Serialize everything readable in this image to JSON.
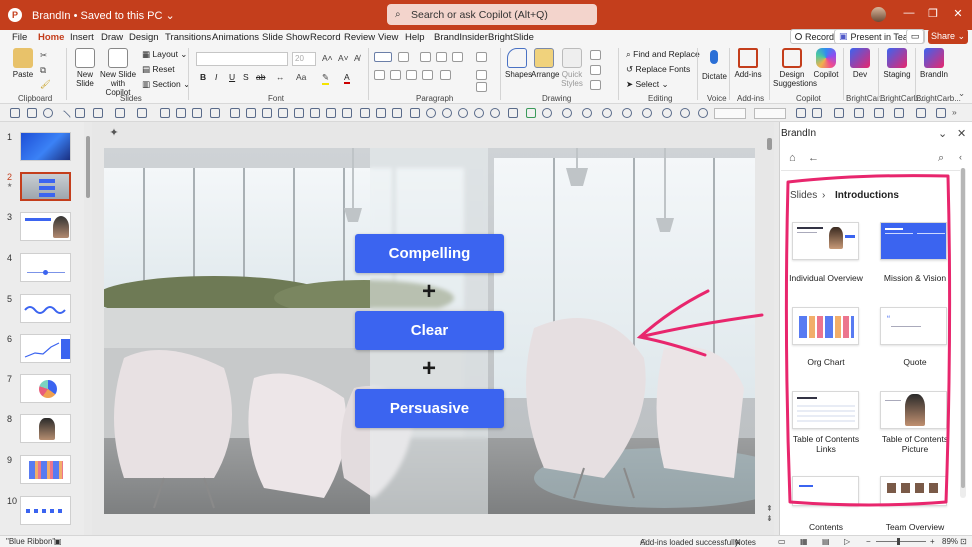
{
  "app": {
    "logo": "P",
    "document_title": "BrandIn • Saved to this PC ⌄",
    "search_placeholder": "Search or ask Copilot (Alt+Q)",
    "brand_color": "#c43e1c"
  },
  "tabs": [
    "File",
    "Home",
    "Insert",
    "Draw",
    "Design",
    "Transitions",
    "Animations",
    "Slide Show",
    "Record",
    "Review",
    "View",
    "Help",
    "BrandInsider",
    "BrightSlide"
  ],
  "active_tab": "Home",
  "actions": {
    "record": "Record",
    "present": "Present in Teams",
    "share": "Share ⌄"
  },
  "ribbon": {
    "groups": [
      "Clipboard",
      "Slides",
      "Font",
      "Paragraph",
      "Drawing",
      "Editing",
      "Voice",
      "Add-ins",
      "Copilot",
      "BrightCar...",
      "BrightCarb...",
      "BrightCarb..."
    ],
    "clipboard": {
      "paste": "Paste"
    },
    "slides": {
      "new_slide": "New Slide",
      "new_slide_copilot": "New Slide with Copilot",
      "layout": "Layout ⌄",
      "reset": "Reset",
      "section": "Section ⌄"
    },
    "font": {
      "size": "20",
      "bold": "B",
      "italic": "I",
      "underline": "U",
      "strike": "S",
      "shadow": "ab"
    },
    "drawing": {
      "shapes": "Shapes",
      "arrange": "Arrange",
      "quick_styles": "Quick Styles"
    },
    "editing": {
      "find_replace": "Find and Replace",
      "replace_fonts": "Replace Fonts",
      "select": "Select ⌄"
    },
    "voice": {
      "dictate": "Dictate"
    },
    "addins": {
      "addins": "Add-ins"
    },
    "copilot": {
      "design_suggestions": "Design Suggestions",
      "copilot": "Copilot"
    },
    "brand": {
      "dev": "Dev",
      "staging": "Staging",
      "brandin": "BrandIn"
    }
  },
  "thumbnails": [
    "1",
    "2",
    "3",
    "4",
    "5",
    "6",
    "7",
    "8",
    "9",
    "10"
  ],
  "selected_slide": "2",
  "slide": {
    "pills": [
      "Compelling",
      "Clear",
      "Persuasive"
    ],
    "plus": "+"
  },
  "pane": {
    "title": "BrandIn",
    "breadcrumb_root": "Slides",
    "breadcrumb_sep": "›",
    "breadcrumb_current": "Introductions",
    "cards": [
      {
        "label": "Individual Overview"
      },
      {
        "label": "Mission & Vision"
      },
      {
        "label": "Org Chart"
      },
      {
        "label": "Quote"
      },
      {
        "label": "Table of Contents Links"
      },
      {
        "label": "Table of Contents Picture"
      },
      {
        "label": "Contents"
      },
      {
        "label": "Team Overview"
      }
    ],
    "annotation_color": "#e8266d"
  },
  "status": {
    "theme": "\"Blue Ribbon\"",
    "addins": "Add-ins loaded successfully",
    "notes": "Notes",
    "zoom": "89%"
  }
}
